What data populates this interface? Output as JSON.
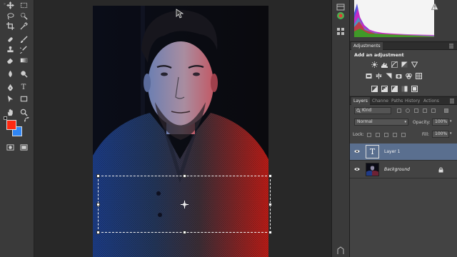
{
  "icons": {
    "tools": [
      "move-tool",
      "marquee-tool",
      "lasso-tool",
      "quick-select-tool",
      "crop-tool",
      "eyedropper-tool",
      "healing-brush-tool",
      "brush-tool",
      "clone-stamp-tool",
      "history-brush-tool",
      "eraser-tool",
      "gradient-tool",
      "blur-tool",
      "dodge-tool",
      "pen-tool",
      "type-tool",
      "path-select-tool",
      "rectangle-tool",
      "hand-tool",
      "zoom-tool"
    ]
  },
  "colors": {
    "foreground": "#ff2a12",
    "background": "#2f86f5",
    "layer_selected": "#5a6f8f",
    "panel_bg": "#434343"
  },
  "histogram": {
    "warning_icon": "warning-icon"
  },
  "adjustments": {
    "tab": "Adjustments",
    "title": "Add an adjustment"
  },
  "layers_panel": {
    "tabs": [
      "Layers",
      "Channe",
      "Paths",
      "History",
      "Actions"
    ],
    "filter_label": "Kind",
    "blend_mode": "Normal",
    "opacity_label": "Opacity:",
    "opacity_value": "100%",
    "lock_label": "Lock:",
    "fill_label": "Fill:",
    "fill_value": "100%",
    "layers": [
      {
        "name": "Layer 1",
        "type_glyph": "T",
        "selected": true
      },
      {
        "name": "Background",
        "selected": false
      }
    ]
  }
}
